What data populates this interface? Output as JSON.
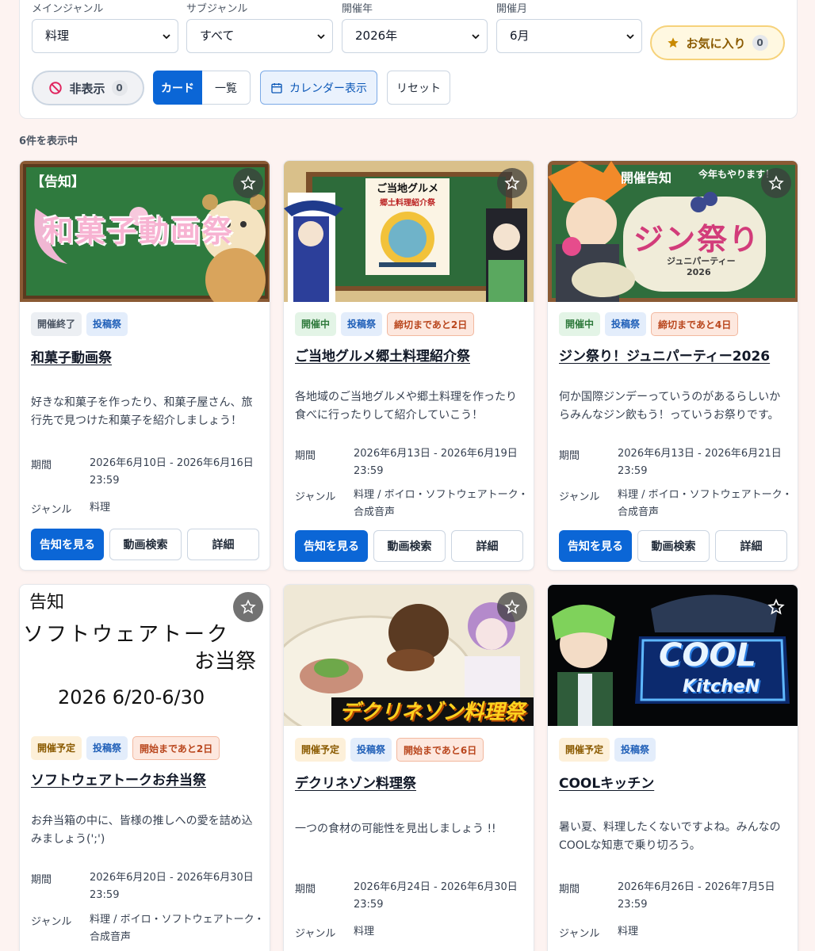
{
  "filters": {
    "main_genre": {
      "label": "メインジャンル",
      "value": "料理"
    },
    "sub_genre": {
      "label": "サブジャンル",
      "value": "すべて"
    },
    "year": {
      "label": "開催年",
      "value": "2026年"
    },
    "month": {
      "label": "開催月",
      "value": "6月"
    },
    "favorites": {
      "label": "お気に入り",
      "count": "0"
    },
    "hidden": {
      "label": "非表示",
      "count": "0"
    },
    "view_card": "カード",
    "view_list": "一覧",
    "calendar": "カレンダー表示",
    "reset": "リセット"
  },
  "result_count": "6件を表示中",
  "labels": {
    "period": "期間",
    "genre": "ジャンル",
    "announce": "告知を見る",
    "search": "動画検索",
    "detail": "詳細"
  },
  "colors": {
    "primary": "#0b66d6",
    "favorite": "#f6d27a",
    "background": "#fdf3f1"
  },
  "cards": [
    {
      "title": "和菓子動画祭",
      "badges": [
        {
          "text": "開催終了",
          "kind": "end"
        },
        {
          "text": "投稿祭",
          "kind": "post"
        }
      ],
      "description": "好きな和菓子を作ったり、和菓子屋さん、旅行先で見つけた和菓子を紹介しましょう！",
      "period": "2026年6月10日 - 2026年6月16日 23:59",
      "genre": "料理",
      "thumb": {
        "tag": "【告知】",
        "title": "和菓子動画祭"
      }
    },
    {
      "title": "ご当地グルメ郷土料理紹介祭",
      "badges": [
        {
          "text": "開催中",
          "kind": "open"
        },
        {
          "text": "投稿祭",
          "kind": "post"
        },
        {
          "text": "締切まであと2日",
          "kind": "dead"
        }
      ],
      "description": "各地域のご当地グルメや郷土料理を作ったり食べに行ったりして紹介していこう！",
      "period": "2026年6月13日 - 2026年6月19日 23:59",
      "genre": "料理 / ボイロ・ソフトウェアトーク・合成音声",
      "thumb": {
        "line1": "ご当地グルメ",
        "line2": "郷土料理紹介祭"
      }
    },
    {
      "title": "ジン祭り！ジュニパーティー2026",
      "badges": [
        {
          "text": "開催中",
          "kind": "open"
        },
        {
          "text": "投稿祭",
          "kind": "post"
        },
        {
          "text": "締切まであと4日",
          "kind": "dead"
        }
      ],
      "description": "何か国際ジンデーっていうのがあるらしいからみんなジン飲もう！っていうお祭りです。",
      "period": "2026年6月13日 - 2026年6月21日 23:59",
      "genre": "料理 / ボイロ・ソフトウェアトーク・合成音声",
      "thumb": {
        "tag": "開催告知",
        "tag2": "今年もやります！",
        "title": "ジン祭り",
        "sub": "ジュニパーティー",
        "year": "2026"
      }
    },
    {
      "title": "ソフトウェアトークお弁当祭",
      "badges": [
        {
          "text": "開催予定",
          "kind": "soon"
        },
        {
          "text": "投稿祭",
          "kind": "post"
        },
        {
          "text": "開始まであと2日",
          "kind": "dead"
        }
      ],
      "description": "お弁当箱の中に、皆様の推しへの愛を詰め込みましょう(';')",
      "period": "2026年6月20日 - 2026年6月30日 23:59",
      "genre": "料理 / ボイロ・ソフトウェアトーク・合成音声",
      "thumb": {
        "line1": "告知",
        "line2": "ソフトウェアトーク",
        "line3": "お当祭",
        "line4": "2026 6/20-6/30"
      }
    },
    {
      "title": "デクリネゾン料理祭",
      "badges": [
        {
          "text": "開催予定",
          "kind": "soon"
        },
        {
          "text": "投稿祭",
          "kind": "post"
        },
        {
          "text": "開始まであと6日",
          "kind": "dead"
        }
      ],
      "description": "一つの食材の可能性を見出しましょう !!",
      "period": "2026年6月24日 - 2026年6月30日 23:59",
      "genre": "料理",
      "thumb": {
        "title": "デクリネゾン料理祭"
      }
    },
    {
      "title": "COOLキッチン",
      "badges": [
        {
          "text": "開催予定",
          "kind": "soon"
        },
        {
          "text": "投稿祭",
          "kind": "post"
        }
      ],
      "description": "暑い夏、料理したくないですよね。みんなのCOOLな知恵で乗り切ろう。",
      "period": "2026年6月26日 - 2026年7月5日 23:59",
      "genre": "料理",
      "thumb": {
        "line1": "COOL",
        "line2": "KitcheN"
      }
    }
  ]
}
